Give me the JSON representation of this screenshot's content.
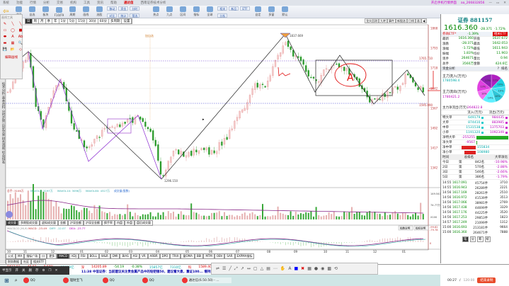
{
  "menubar": {
    "items": [
      "系统",
      "功能",
      "行情",
      "分析",
      "交易",
      "机构",
      "工具",
      "资讯",
      "帮助"
    ],
    "brand": "通达信",
    "window_title": "西南证券技术分析",
    "right_text": "开启手机行情界面",
    "user": "aa_266832856",
    "min": "—",
    "max": "▭",
    "close": "✕"
  },
  "toolbar": {
    "big": [
      "返回",
      "自选",
      "板块",
      "F10/F9",
      "周期",
      "画线",
      "选股",
      "热点",
      "九点",
      "区间",
      "指标",
      "全球",
      "自定",
      "多窗",
      "默认"
    ],
    "small": [
      "移动",
      "资金",
      "分时",
      "对比",
      "统计",
      "筛选",
      "相关",
      "新品",
      "ETF",
      "分析"
    ]
  },
  "periods": [
    "日",
    "周",
    "月",
    "季",
    "年",
    "1分",
    "5分",
    "15分",
    "30分",
    "60分",
    "多周期",
    "设置"
  ],
  "chart_tabs": [
    "龙头回测",
    "九转",
    "事件",
    "新股选",
    "日线",
    "画",
    "◀|"
  ],
  "draw_panel": {
    "header": "画线工具",
    "tools": [
      "✎",
      "╲",
      "╲",
      "▭",
      "◯",
      "■",
      "⬬",
      "A",
      "Ab",
      "▬",
      "▦",
      "🔍",
      "💾",
      "📂",
      "◇"
    ],
    "edit_label": "编辑画线"
  },
  "left_tabs": "技术分析 基本资料 分时走势 历史交易 财务透视 综合排名",
  "chart": {
    "price_labels": [
      "1868",
      "1793",
      "1718",
      "1642",
      "1567",
      "1492",
      "1417",
      "1342"
    ],
    "high_label": "1837.669",
    "low_label": "1296.150",
    "level_upper": "1765.710",
    "level_lower": "1595.090",
    "flag_label": "加自选",
    "annotation_a": "A"
  },
  "volume": {
    "legend": [
      "总手: 3106万",
      "MAVOL5: 3197万",
      "MAVOL10: 3096万",
      "MAVOL60: 4327万",
      "成交量(股数)"
    ],
    "axis": [
      "149.54万",
      "74.77万",
      "X100"
    ],
    "tabs": [
      "成交量",
      "多期股成交量",
      "虚拟成交量",
      "金额",
      "沪深金额",
      "沪深全金额",
      "换手率",
      "内盘",
      "外盘",
      "盘后成交量"
    ]
  },
  "macd": {
    "legend": [
      "MACD(12,26,9)",
      "MACD: -23.49",
      "DIFF: -12.07",
      "DEA: -23.77"
    ],
    "buttons": [
      "指数说明",
      "指标说明"
    ],
    "axis": [
      "-99.82",
      "-79.78",
      "0"
    ]
  },
  "x_axis": [
    "10",
    "11",
    "12",
    "01",
    "02",
    "03",
    "04",
    "05",
    "06",
    "07",
    "08",
    "09",
    "10",
    "11",
    "12",
    "01"
  ],
  "indicator_tabs": [
    "公式",
    "MA",
    "指标广场",
    "口",
    "更多",
    "MACD",
    "KDJ",
    "RSI",
    "BOLL",
    "W&R",
    "DMI",
    "BIAS",
    "ASI",
    "VR",
    "ARBR",
    "DPO",
    "TRIX",
    "量OMA",
    "BBI",
    "MTM",
    "OBV",
    "SAR",
    "EXPMA指标"
  ],
  "bottom_tabs": [
    "财务数据",
    "社区",
    "相关ETF"
  ],
  "right_panel": {
    "title": "证券 881157",
    "price": "1616.360",
    "change": "-28.371",
    "pct": "-1.72%",
    "etf": {
      "name": "券商ETF*",
      "pct": "-1.39%",
      "badge": "相关ETF"
    },
    "quote": [
      [
        "最新",
        "1616.360",
        "开盘",
        "1637.672"
      ],
      [
        "涨跌",
        "-28.371",
        "最高",
        "1642.053"
      ],
      [
        "涨幅",
        "-1.72%",
        "最低",
        "1611.943"
      ],
      [
        "振幅",
        "1.83%",
        "均价",
        "11.903"
      ],
      [
        "现手",
        "264671",
        "量比",
        "0.94"
      ],
      [
        "总手",
        "3560万",
        "金额",
        "424.6亿"
      ]
    ],
    "fund_header": "资金分析",
    "fund_help": "?",
    "fund_rank": "排名",
    "inflow_label": "主力流入(万元)",
    "inflow": "1780598.4",
    "outflow_label": "主力流出(万元)",
    "outflow": "1780421.2",
    "pie": [
      "11%",
      "10%",
      "10%",
      "10%",
      "14%",
      "10%",
      "13%",
      "13%"
    ],
    "net_label": "主力净流出(万元)",
    "net": "264822.8",
    "flow_head": [
      "",
      "流入(万元)",
      "流出(万元)"
    ],
    "flows": [
      [
        "特大单",
        "649179",
        "984435"
      ],
      [
        "大单",
        "874410",
        "883985"
      ],
      [
        "中单",
        "1531538",
        "1375703"
      ],
      [
        "小单",
        "1191320",
        "1092349"
      ]
    ],
    "nets": [
      [
        "净特大单",
        "-255255"
      ],
      [
        "净大单",
        "-9567"
      ],
      [
        "净中单",
        "155834"
      ],
      [
        "净小单",
        "108980"
      ]
    ],
    "rank_head": [
      "时间",
      "总排名",
      "大单净比"
    ],
    "ranks": [
      [
        "今日",
        "第",
        "842名",
        "-10.98%"
      ],
      [
        "2日",
        "第",
        "570名",
        "-2.88%"
      ],
      [
        "3日",
        "第",
        "546名",
        "-2.66%"
      ],
      [
        "5日",
        "第",
        "386名",
        "-1.79%"
      ]
    ],
    "ticks": [
      [
        "14:55",
        "1617.091",
        "45754手",
        "3710"
      ],
      [
        "14:55",
        "1616.943",
        "26289手",
        "2221"
      ],
      [
        "14:56",
        "1617.169",
        "28261手",
        "2510"
      ],
      [
        "14:56",
        "1616.972",
        "41539手",
        "3513"
      ],
      [
        "14:56",
        "1617.066",
        "38981手",
        "2769"
      ],
      [
        "14:56",
        "1617.438",
        "44699手",
        "3329"
      ],
      [
        "14:56",
        "1617.176",
        "44225手",
        "3520"
      ],
      [
        "14:56",
        "1617.253",
        "29853手",
        "1823"
      ],
      [
        "14:57",
        "1617.249",
        "21099手",
        "1312"
      ],
      [
        "15:00",
        "1616.693",
        "213181手",
        "9664"
      ],
      [
        "15:00",
        "1616.360",
        "264671手",
        "7888"
      ]
    ],
    "tick_tabs": [
      "笔",
      "分",
      "筹",
      "统"
    ]
  },
  "status": [
    "8412.83",
    "49.82",
    "0.60%",
    "12699亿",
    "深",
    "14205.89",
    "-54.19",
    "-0.38%",
    "15857亿",
    "7310亿",
    "科",
    "1589.40",
    "-1.76",
    "-0.12%",
    "930亿"
  ],
  "ticker": "11:38 中信证券：当前建议关注贵金属产品中的铂钯银50，建议看大盘，重证100...    增持重大开户、...",
  "float_bar": [
    "半显示",
    "开",
    "关",
    "删",
    "存",
    "⚙",
    "❐",
    "✕"
  ],
  "draw_bar": [
    "⇌",
    "☰",
    "╱",
    "⤢",
    "↗",
    "↔",
    "▢",
    "△",
    "▤",
    "⋯",
    "✋",
    "A",
    "■",
    "✖",
    "▦",
    "●",
    "◉",
    "▩",
    "⟲"
  ],
  "taskbar": [
    "QQ",
    "理财宝飞",
    "QQ",
    "QQ",
    "通达信(6.50.50) - ..."
  ],
  "recording": {
    "time": "00:27",
    "total": "120:00",
    "stop": "结束录制"
  }
}
